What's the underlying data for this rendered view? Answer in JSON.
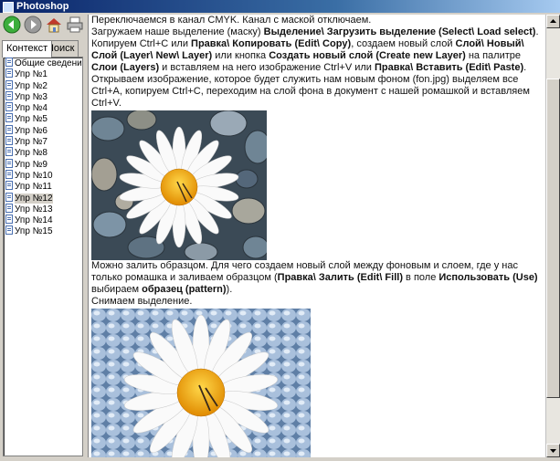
{
  "window": {
    "title": "Photoshop"
  },
  "toolbar": {
    "buttons": [
      {
        "name": "back-button",
        "icon": "back-arrow-icon"
      },
      {
        "name": "forward-button",
        "icon": "forward-arrow-icon"
      },
      {
        "name": "home-button",
        "icon": "home-icon"
      },
      {
        "name": "print-button",
        "icon": "printer-icon"
      }
    ]
  },
  "tabs": [
    {
      "label": "Контекст",
      "active": true
    },
    {
      "label": "Поиск",
      "active": false
    }
  ],
  "tree": {
    "items": [
      "Общие сведения",
      "Упр №1",
      "Упр №2",
      "Упр №3",
      "Упр №4",
      "Упр №5",
      "Упр №6",
      "Упр №7",
      "Упр №8",
      "Упр №9",
      "Упр №10",
      "Упр №11",
      "Упр №12",
      "Упр №13",
      "Упр №14",
      "Упр №15"
    ],
    "selected_index": 12
  },
  "article": {
    "p1": "Переключаемся в канал CMYK. Канал с маской отключаем.",
    "p2": {
      "t1": "Загружаем наше выделение (маску) ",
      "b1": "Выделение\\ Загрузить выделение (Select\\ Load select)",
      "t2": "."
    },
    "p3": {
      "t1": "Копируем Ctrl+C или ",
      "b1": "Правка\\ Копировать (Edit\\ Copy)",
      "t2": ", создаем новый слой ",
      "b2": "Слой\\ Новый\\ Слой (Layer\\ New\\ Layer)",
      "t3": " или кнопка ",
      "b3": "Создать новый слой (Create new Layer)",
      "t4": " на палитре ",
      "b4": "Слои (Layers)",
      "t5": " и вставляем на него изображение Ctrl+V или ",
      "b5": "Правка\\ Вставить (Edit\\ Paste)",
      "t6": "."
    },
    "p4": "Открываем изображение, которое будет служить нам новым фоном (fon.jpg) выделяем все Ctrl+A, копируем Ctrl+C, переходим на слой фона в документ с нашей ромашкой и вставляем Ctrl+V.",
    "p5": {
      "t1": "Можно залить образцом. Для чего создаем новый слой между фоновым и слоем, где у нас только ромашка и заливаем образцом (",
      "b1": "Правка\\ Залить (Edit\\ Fill)",
      "t2": " в поле ",
      "b2": "Использовать (Use)",
      "t3": " выбираем ",
      "b3": "образец (pattern)",
      "t4": ")."
    },
    "p6": "Снимаем выделение."
  }
}
